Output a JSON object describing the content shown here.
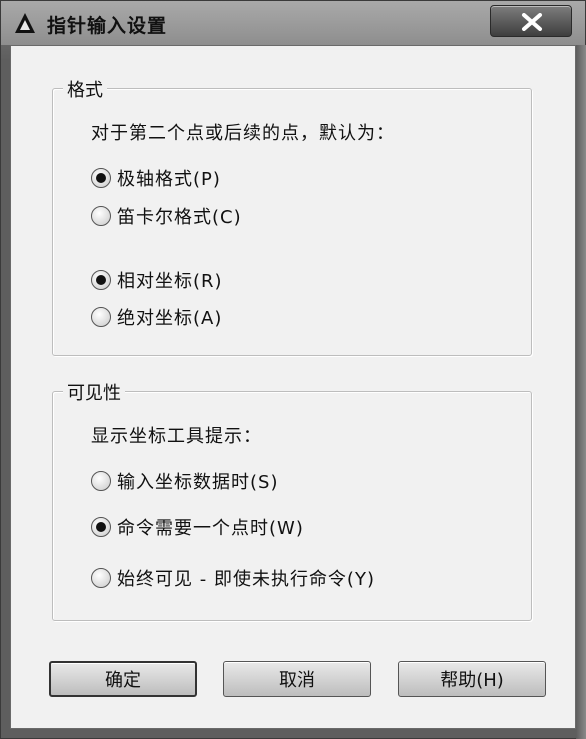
{
  "window": {
    "title": "指针输入设置",
    "app_icon": "autocad-icon",
    "close_icon": "close-icon"
  },
  "format_group": {
    "title": "格式",
    "prompt": "对于第二个点或后续的点，默认为：",
    "options_a": [
      {
        "label": "极轴格式(P)",
        "checked": true
      },
      {
        "label": "笛卡尔格式(C)",
        "checked": false
      }
    ],
    "options_b": [
      {
        "label": "相对坐标(R)",
        "checked": true
      },
      {
        "label": "绝对坐标(A)",
        "checked": false
      }
    ]
  },
  "visibility_group": {
    "title": "可见性",
    "prompt": "显示坐标工具提示：",
    "options": [
      {
        "label": "输入坐标数据时(S)",
        "checked": false
      },
      {
        "label": "命令需要一个点时(W)",
        "checked": true
      },
      {
        "label": "始终可见 - 即使未执行命令(Y)",
        "checked": false
      }
    ]
  },
  "buttons": {
    "ok": "确定",
    "cancel": "取消",
    "help": "帮助(H)"
  }
}
